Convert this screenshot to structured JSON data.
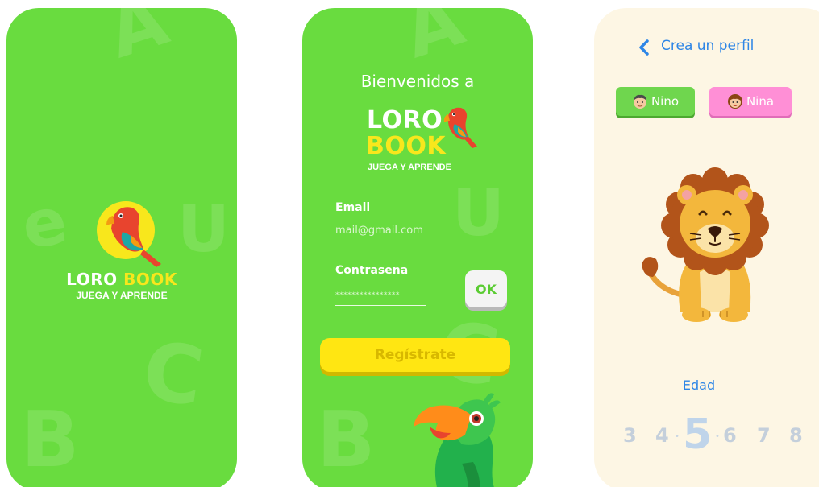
{
  "colors": {
    "green": "#69dc3f",
    "yellow": "#ffe612",
    "cream": "#fdf6e4",
    "blue": "#2e86e6",
    "pink": "#ff8fd6"
  },
  "background_letters": {
    "screen1": [
      "A",
      "e",
      "U",
      "C",
      "B"
    ],
    "screen2": [
      "A",
      "U",
      "C",
      "B"
    ]
  },
  "splash": {
    "brand_loro": "LORO",
    "brand_book": "BOOK",
    "tagline": "JUEGA Y APRENDE",
    "icon": "parrot-icon"
  },
  "login": {
    "welcome": "Bienvenidos a",
    "brand_loro": "LORO",
    "brand_book": "BOOK",
    "tagline": "JUEGA Y APRENDE",
    "email_label": "Email",
    "email_placeholder": "mail@gmail.com",
    "password_label": "Contrasena",
    "password_placeholder": "****************",
    "ok_label": "OK",
    "register_label": "Regístrate",
    "mascot": "parrot-mascot"
  },
  "profile": {
    "title": "Crea un perfil",
    "back_icon": "chevron-left-icon",
    "boy_label": "Nino",
    "girl_label": "Nina",
    "avatar": "lion-illustration",
    "age_label": "Edad",
    "ages": [
      "3",
      "4",
      "5",
      "6",
      "7",
      "8"
    ],
    "selected_age": "5"
  }
}
